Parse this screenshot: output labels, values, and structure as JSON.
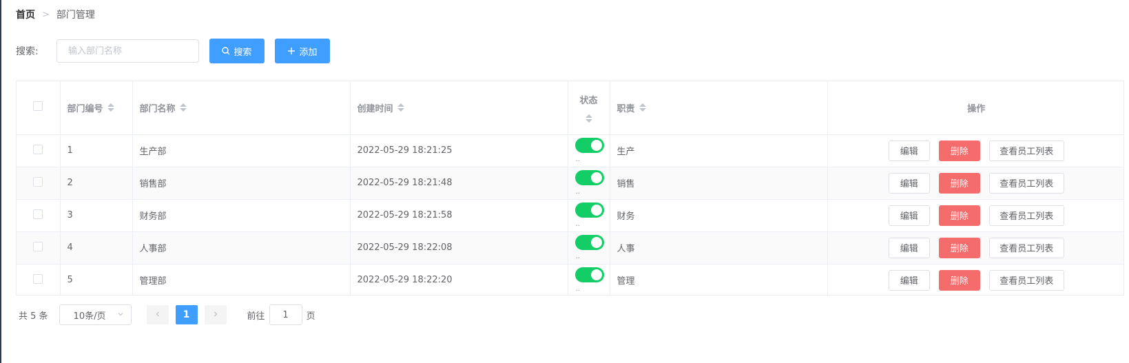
{
  "breadcrumb": {
    "home": "首页",
    "separator": ">",
    "current": "部门管理"
  },
  "search": {
    "label": "搜索:",
    "placeholder": "输入部门名称",
    "value": "",
    "search_label": "搜索",
    "add_label": "添加"
  },
  "table": {
    "headers": {
      "id": "部门编号",
      "name": "部门名称",
      "created": "创建时间",
      "status": "状态",
      "duty": "职责",
      "actions": "操作"
    },
    "rows": [
      {
        "id": "1",
        "name": "生产部",
        "created": "2022-05-29 18:21:25",
        "status": true,
        "duty": "生产"
      },
      {
        "id": "2",
        "name": "销售部",
        "created": "2022-05-29 18:21:48",
        "status": true,
        "duty": "销售"
      },
      {
        "id": "3",
        "name": "财务部",
        "created": "2022-05-29 18:21:58",
        "status": true,
        "duty": "财务"
      },
      {
        "id": "4",
        "name": "人事部",
        "created": "2022-05-29 18:22:08",
        "status": true,
        "duty": "人事"
      },
      {
        "id": "5",
        "name": "管理部",
        "created": "2022-05-29 18:22:20",
        "status": true,
        "duty": "管理"
      }
    ],
    "actions": {
      "edit": "编辑",
      "delete": "删除",
      "view": "查看员工列表"
    },
    "switch_color": "#13ce66"
  },
  "pagination": {
    "total": "共 5 条",
    "page_size": "10条/页",
    "current_page": "1",
    "goto_label": "前往",
    "goto_value": "1",
    "page_suffix": "页"
  },
  "colors": {
    "primary": "#409eff",
    "danger": "#f56c6c",
    "success": "#13ce66"
  }
}
